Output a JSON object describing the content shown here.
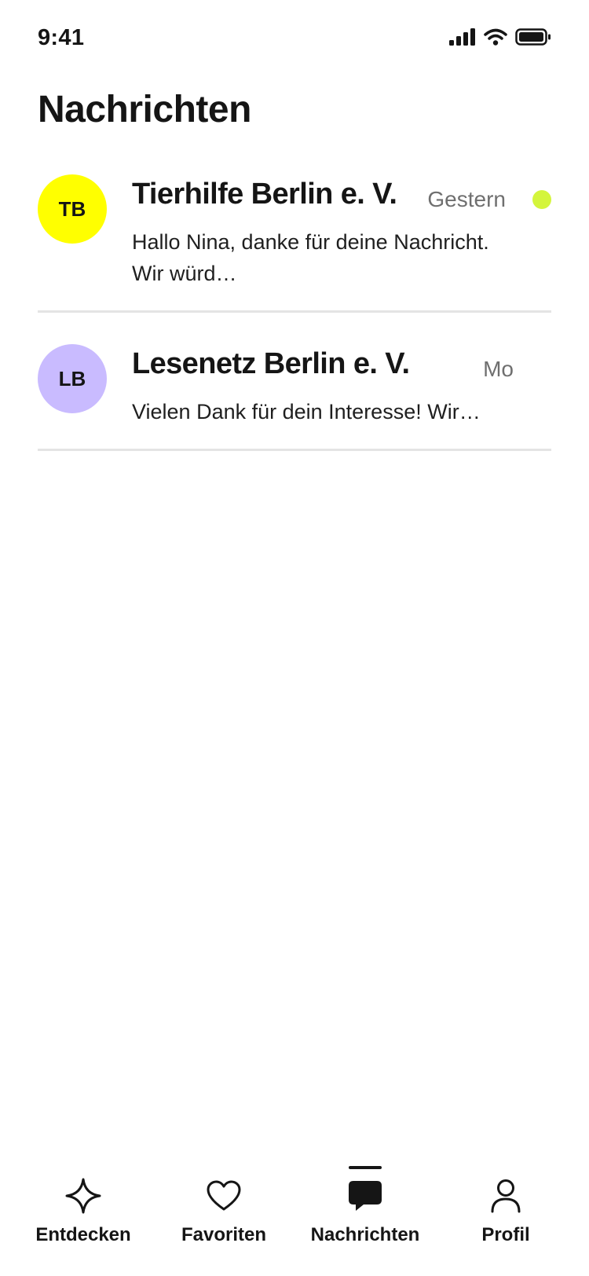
{
  "status_bar": {
    "time": "9:41",
    "icons": [
      "signal-icon",
      "wifi-icon",
      "battery-icon"
    ]
  },
  "page": {
    "title": "Nachrichten"
  },
  "conversations": [
    {
      "initials": "TB",
      "name": "Tierhilfe Berlin e. V.",
      "time": "Gestern",
      "preview": "Hallo Nina, danke für deine Nachricht. Wir würd…",
      "unread": true,
      "avatar_color": "#FFFF00"
    },
    {
      "initials": "LB",
      "name": "Lesenetz Berlin e. V.",
      "time": "Mo",
      "preview": "Vielen Dank für dein Interesse! Wir…",
      "unread": false,
      "avatar_color": "#C9BBFF"
    }
  ],
  "tabs": [
    {
      "label": "Entdecken",
      "icon": "sparkle-icon",
      "active": false
    },
    {
      "label": "Favoriten",
      "icon": "heart-icon",
      "active": false
    },
    {
      "label": "Nachrichten",
      "icon": "chat-bubble-icon",
      "active": true
    },
    {
      "label": "Profil",
      "icon": "person-icon",
      "active": false
    }
  ],
  "colors": {
    "unread_dot": "#D4F53C",
    "text_primary": "#151515",
    "text_secondary": "#6F6F6F",
    "divider": "#E4E4E4"
  }
}
